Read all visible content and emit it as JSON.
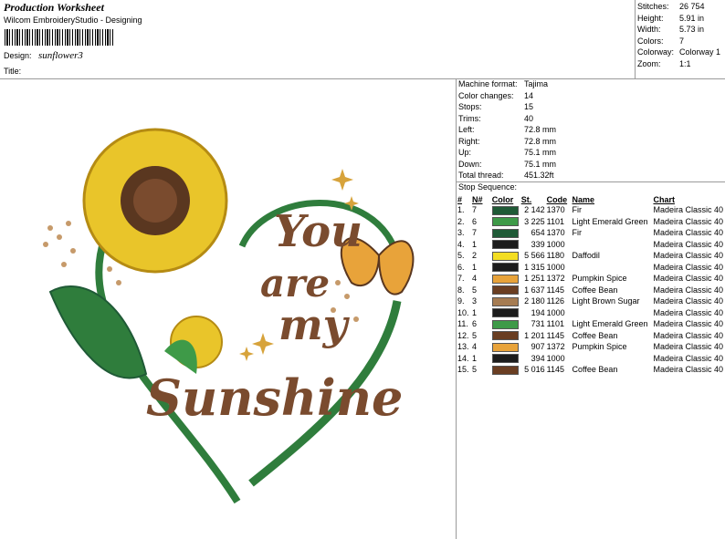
{
  "header": {
    "title": "Production Worksheet",
    "software": "Wilcom EmbroideryStudio - Designing",
    "design_label": "Design:",
    "design_name": "sunflower3",
    "title_label": "Title:"
  },
  "summary": {
    "stitches_label": "Stitches:",
    "stitches": "26 754",
    "height_label": "Height:",
    "height": "5.91 in",
    "width_label": "Width:",
    "width": "5.73 in",
    "colors_label": "Colors:",
    "colors": "7",
    "colorway_label": "Colorway:",
    "colorway": "Colorway 1",
    "zoom_label": "Zoom:",
    "zoom": "1:1"
  },
  "machine": {
    "format_label": "Machine format:",
    "format": "Tajima",
    "color_changes_label": "Color changes:",
    "color_changes": "14",
    "stops_label": "Stops:",
    "stops": "15",
    "trims_label": "Trims:",
    "trims": "40",
    "left_label": "Left:",
    "left": "72.8 mm",
    "right_label": "Right:",
    "right": "72.8 mm",
    "up_label": "Up:",
    "up": "75.1 mm",
    "down_label": "Down:",
    "down": "75.1 mm",
    "thread_label": "Total thread:",
    "thread": "451.32ft"
  },
  "stop_sequence": {
    "label": "Stop Sequence:",
    "headers": {
      "num": "#",
      "n": "N#",
      "color": "Color",
      "st": "St.",
      "code": "Code",
      "name": "Name",
      "chart": "Chart"
    },
    "rows": [
      {
        "num": "1.",
        "n": "7",
        "color": "#1f5a36",
        "st": "2 142",
        "code": "1370",
        "name": "Fir",
        "chart": "Madeira Classic 40"
      },
      {
        "num": "2.",
        "n": "6",
        "color": "#3e9a48",
        "st": "3 225",
        "code": "1101",
        "name": "Light Emerald Green",
        "chart": "Madeira Classic 40"
      },
      {
        "num": "3.",
        "n": "7",
        "color": "#1f5a36",
        "st": "654",
        "code": "1370",
        "name": "Fir",
        "chart": "Madeira Classic 40"
      },
      {
        "num": "4.",
        "n": "1",
        "color": "#1c1c1c",
        "st": "339",
        "code": "1000",
        "name": "",
        "chart": "Madeira Classic 40"
      },
      {
        "num": "5.",
        "n": "2",
        "color": "#f3dd22",
        "st": "5 566",
        "code": "1180",
        "name": "Daffodil",
        "chart": "Madeira Classic 40"
      },
      {
        "num": "6.",
        "n": "1",
        "color": "#1c1c1c",
        "st": "1 315",
        "code": "1000",
        "name": "",
        "chart": "Madeira Classic 40"
      },
      {
        "num": "7.",
        "n": "4",
        "color": "#e8a33a",
        "st": "1 251",
        "code": "1372",
        "name": "Pumpkin Spice",
        "chart": "Madeira Classic 40"
      },
      {
        "num": "8.",
        "n": "5",
        "color": "#6a3e22",
        "st": "1 637",
        "code": "1145",
        "name": "Coffee Bean",
        "chart": "Madeira Classic 40"
      },
      {
        "num": "9.",
        "n": "3",
        "color": "#a67c52",
        "st": "2 180",
        "code": "1126",
        "name": "Light Brown Sugar",
        "chart": "Madeira Classic 40"
      },
      {
        "num": "10.",
        "n": "1",
        "color": "#1c1c1c",
        "st": "194",
        "code": "1000",
        "name": "",
        "chart": "Madeira Classic 40"
      },
      {
        "num": "11.",
        "n": "6",
        "color": "#3e9a48",
        "st": "731",
        "code": "1101",
        "name": "Light Emerald Green",
        "chart": "Madeira Classic 40"
      },
      {
        "num": "12.",
        "n": "5",
        "color": "#6a3e22",
        "st": "1 201",
        "code": "1145",
        "name": "Coffee Bean",
        "chart": "Madeira Classic 40"
      },
      {
        "num": "13.",
        "n": "4",
        "color": "#e8a33a",
        "st": "907",
        "code": "1372",
        "name": "Pumpkin Spice",
        "chart": "Madeira Classic 40"
      },
      {
        "num": "14.",
        "n": "1",
        "color": "#1c1c1c",
        "st": "394",
        "code": "1000",
        "name": "",
        "chart": "Madeira Classic 40"
      },
      {
        "num": "15.",
        "n": "5",
        "color": "#6a3e22",
        "st": "5 016",
        "code": "1145",
        "name": "Coffee Bean",
        "chart": "Madeira Classic 40"
      }
    ]
  },
  "artwork": {
    "line1": "You",
    "line2": "are",
    "line3": "my",
    "line4": "Sunshine",
    "text_color": "#7a4b2e",
    "petal_color": "#e9c52a",
    "leaf_color": "#2f7d3c"
  }
}
